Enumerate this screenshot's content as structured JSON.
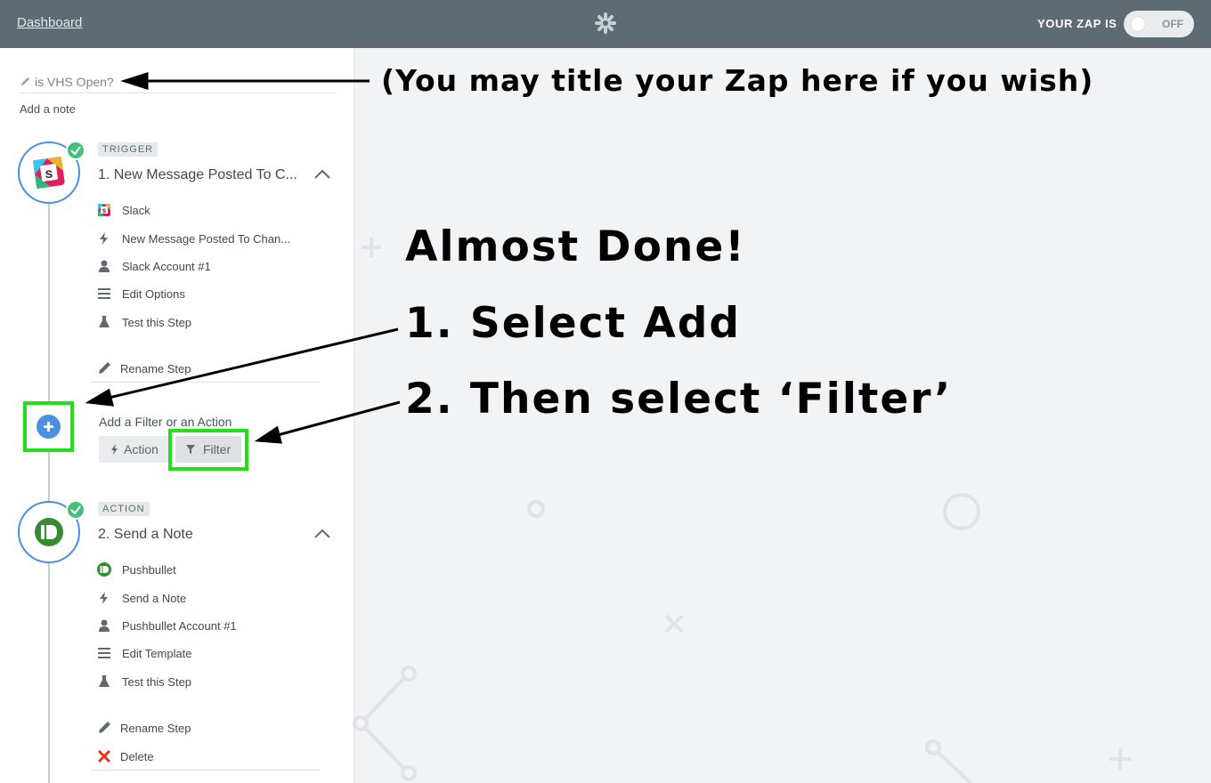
{
  "topbar": {
    "dashboard_link": "Dashboard",
    "logo_icon": "zapier-asterisk-icon",
    "zap_status_label": "YOUR ZAP IS",
    "toggle_state": "OFF"
  },
  "zap": {
    "title": "is VHS Open?",
    "add_note": "Add a note"
  },
  "steps": [
    {
      "badge": "TRIGGER",
      "title": "1. New Message Posted To C...",
      "app_icon": "slack-icon",
      "items": [
        {
          "icon": "slack-icon",
          "label": "Slack"
        },
        {
          "icon": "bolt-icon",
          "label": "New Message Posted To Chan..."
        },
        {
          "icon": "user-icon",
          "label": "Slack Account #1"
        },
        {
          "icon": "lines-icon",
          "label": "Edit Options"
        },
        {
          "icon": "flask-icon",
          "label": "Test this Step"
        }
      ],
      "rename": "Rename Step"
    },
    {
      "badge": "ACTION",
      "title": "2. Send a Note",
      "app_icon": "pushbullet-icon",
      "items": [
        {
          "icon": "pushbullet-icon",
          "label": "Pushbullet"
        },
        {
          "icon": "bolt-icon",
          "label": "Send a Note"
        },
        {
          "icon": "user-icon",
          "label": "Pushbullet Account #1"
        },
        {
          "icon": "lines-icon",
          "label": "Edit Template"
        },
        {
          "icon": "flask-icon",
          "label": "Test this Step"
        }
      ],
      "rename": "Rename Step",
      "delete": "Delete"
    }
  ],
  "add_step": {
    "label": "Add a Filter or an Action",
    "action_button": "Action",
    "filter_button": "Filter"
  },
  "annotations": {
    "title_hint": "(You may title your Zap here if you wish)",
    "almost_done": "Almost Done!",
    "step1": "1. Select Add",
    "step2": "2. Then select ‘Filter’"
  },
  "colors": {
    "topbar": "#5f6b73",
    "accent_blue": "#4a90e2",
    "check_green": "#43c079",
    "highlight_green": "#22e018",
    "delete_red": "#e8321c"
  }
}
